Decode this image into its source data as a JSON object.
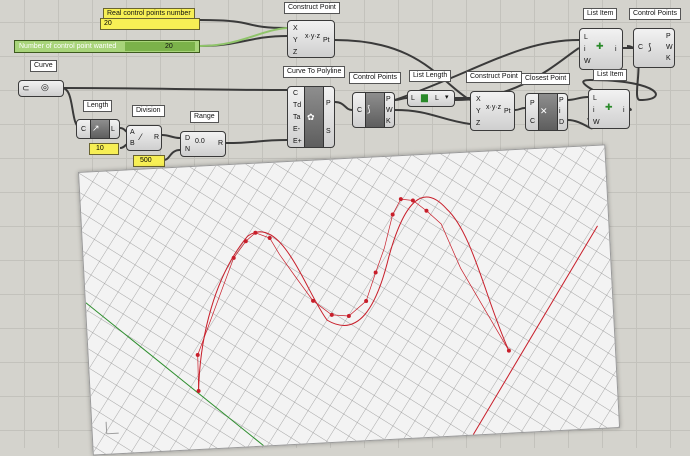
{
  "panels": {
    "real_count_title": "Real control points number",
    "real_count_value": "20",
    "length_value": "10",
    "division_value": "500"
  },
  "slider": {
    "label": "Number of control point wanted",
    "value": "20",
    "color_track": "#a8d47a"
  },
  "components": {
    "curve": "Curve",
    "length": "Length",
    "division": "Division",
    "range": "Range",
    "construct_point_1": "Construct Point",
    "curve_to_polyline": "Curve To Polyline",
    "control_points_1": "Control Points",
    "list_length": "List Length",
    "construct_point_2": "Construct Point",
    "closest_point": "Closest Point",
    "list_item_1": "List Item",
    "list_item_2": "List Item",
    "control_points_2": "Control Points"
  },
  "ports": {
    "xyz": [
      "X",
      "Y",
      "Z"
    ],
    "pt": "Pt",
    "c": "C",
    "l": "L",
    "ab": [
      "A",
      "B"
    ],
    "r": "R",
    "dn": [
      "D",
      "N"
    ],
    "ctp_in": [
      "C",
      "Td",
      "Ta",
      "E-",
      "E+"
    ],
    "ctp_out": [
      "P",
      "S"
    ],
    "cp_out": [
      "P",
      "W",
      "K"
    ],
    "cl_in": [
      "P",
      "C"
    ],
    "cl_out": [
      "P",
      "i",
      "D"
    ],
    "li_in": [
      "L",
      "i",
      "W"
    ],
    "li_out": "i"
  },
  "colors": {
    "canvas": "#d4d3cd",
    "curve_red": "#c81e2a",
    "axis_green": "#2f8f2f",
    "wire": "#3a3a3a"
  }
}
